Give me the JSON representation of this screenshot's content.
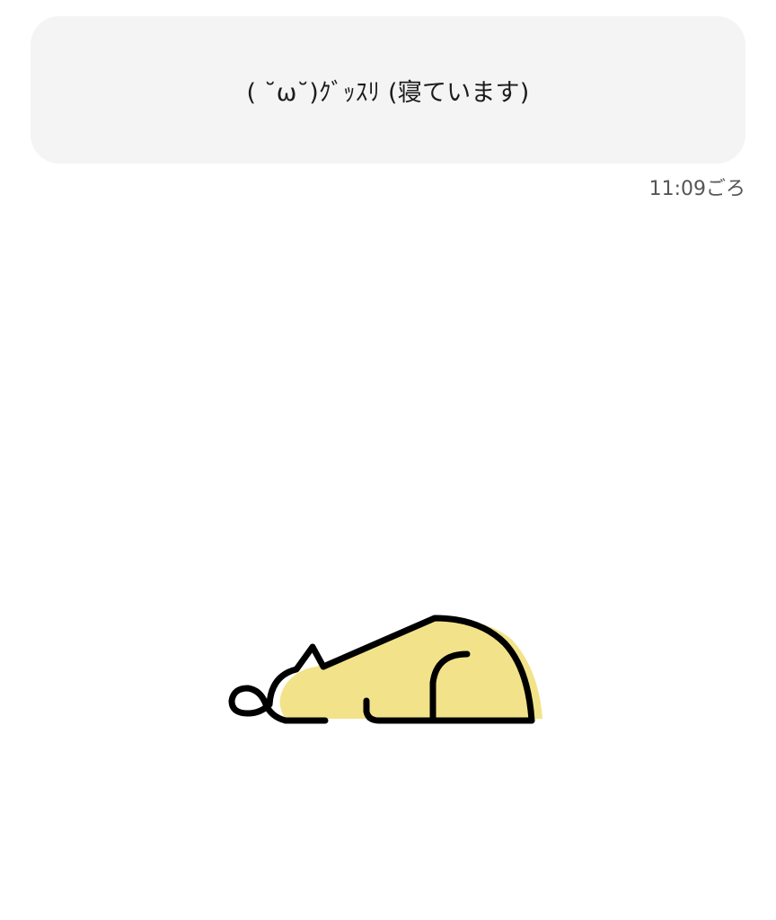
{
  "status": {
    "message": "( ˘ω˘)ｸﾞｯｽﾘ (寝ています)",
    "time": "11:09ごろ"
  },
  "illustration": {
    "icon": "sleeping-cat-icon",
    "fill_color": "#f2e38a",
    "stroke_color": "#000000"
  },
  "colors": {
    "bubble_background": "#f4f4f4",
    "text": "#1c1c1c",
    "time_text": "#555555"
  }
}
